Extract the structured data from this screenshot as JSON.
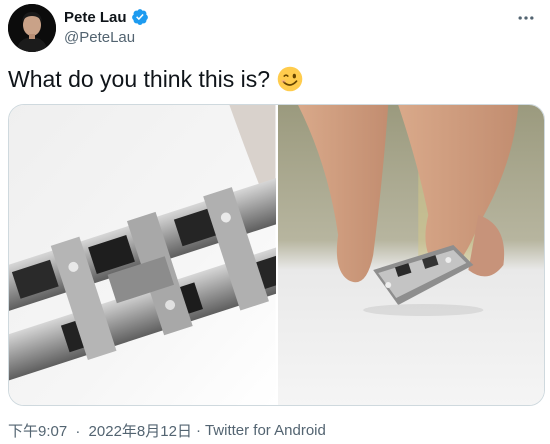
{
  "author": {
    "display_name": "Pete Lau",
    "handle": "@PeteLau",
    "verified_badge_icon": "verified-badge-icon",
    "avatar_icon": "profile-photo"
  },
  "menu": {
    "more_icon": "more-horizontal-icon"
  },
  "tweet": {
    "text": "What do you think this is?",
    "emoji_icon": "winking-face-emoji"
  },
  "media": {
    "count": 2
  },
  "meta": {
    "time": "下午9:07",
    "separator": "·",
    "date": "2022年8月12日",
    "source": "Twitter for Android"
  },
  "colors": {
    "text_primary": "#0f1419",
    "text_secondary": "#536471",
    "verified_blue": "#1d9bf0",
    "border": "#cfd9de"
  }
}
